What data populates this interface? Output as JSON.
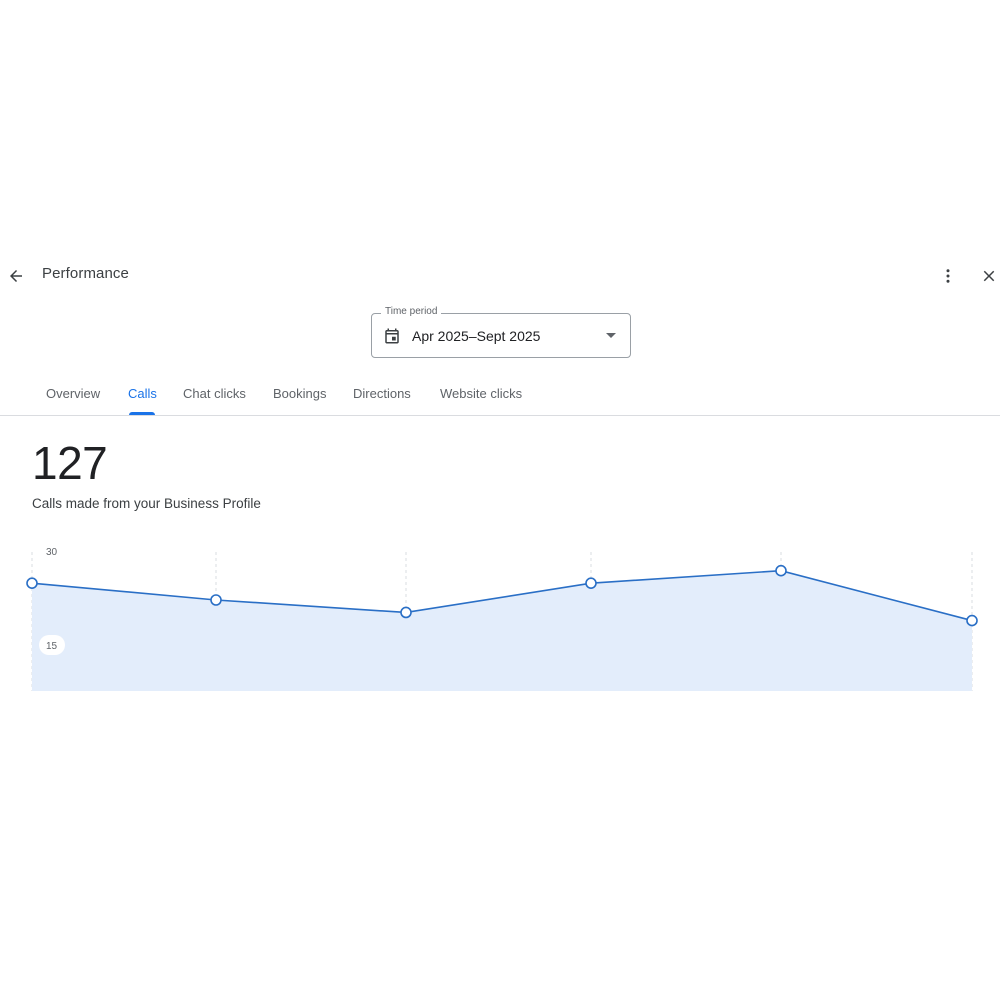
{
  "header": {
    "title": "Performance",
    "back_icon": "arrow-back-icon",
    "more_icon": "more-vert-icon",
    "close_icon": "close-icon"
  },
  "time_period": {
    "label": "Time period",
    "value": "Apr 2025–Sept 2025",
    "icon": "calendar-icon"
  },
  "tabs": [
    {
      "label": "Overview",
      "active": false
    },
    {
      "label": "Calls",
      "active": true
    },
    {
      "label": "Chat clicks",
      "active": false
    },
    {
      "label": "Bookings",
      "active": false
    },
    {
      "label": "Directions",
      "active": false
    },
    {
      "label": "Website clicks",
      "active": false
    }
  ],
  "metric": {
    "value": "127",
    "caption": "Calls made from your Business Profile"
  },
  "colors": {
    "accent": "#1a73e8",
    "line": "#2a6fc6",
    "area": "#e3edfb"
  },
  "chart_data": {
    "type": "area",
    "y_ticks": [
      "30",
      "15"
    ],
    "values": [
      25,
      22.3,
      20.3,
      25,
      27,
      19
    ],
    "ylim": [
      7.7,
      30
    ],
    "grid": "vertical-dashed"
  }
}
